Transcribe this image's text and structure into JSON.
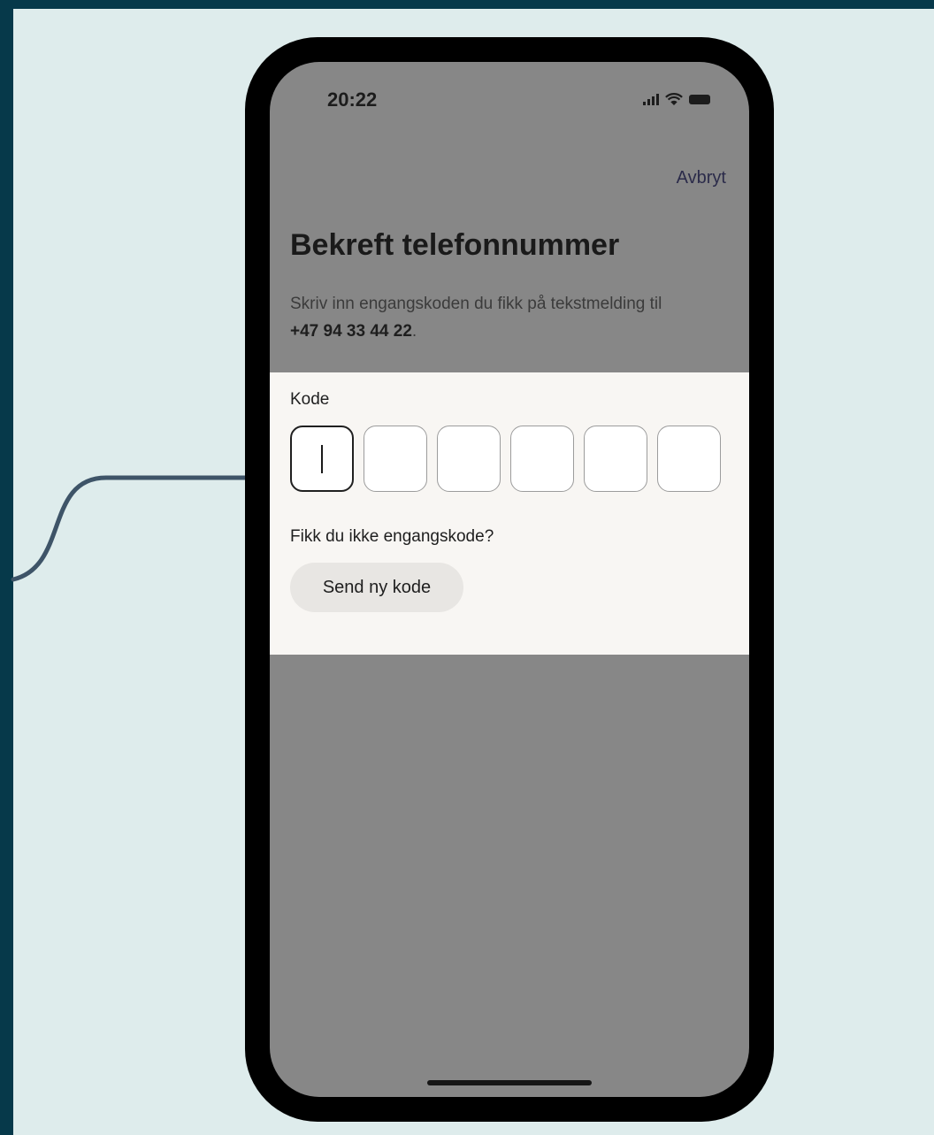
{
  "status_bar": {
    "time": "20:22",
    "icons": [
      "cellular-signal-icon",
      "wifi-icon",
      "battery-icon"
    ]
  },
  "header": {
    "cancel_label": "Avbryt",
    "title": "Bekreft telefonnummer",
    "description_prefix": "Skriv inn engangskoden du fikk på tekstmelding til ",
    "phone_number": "+47 94 33 44 22",
    "description_suffix": "."
  },
  "code_form": {
    "label": "Kode",
    "digits": [
      "",
      "",
      "",
      "",
      "",
      ""
    ]
  },
  "resend": {
    "question": "Fikk du ikke engangskode?",
    "button_label": "Send ny kode"
  },
  "colors": {
    "outer_background": "#06394a",
    "canvas_background": "#deecec",
    "overlay_gray": "#878787",
    "sheet_background": "#f8f6f3",
    "connector": "#3e5468"
  }
}
